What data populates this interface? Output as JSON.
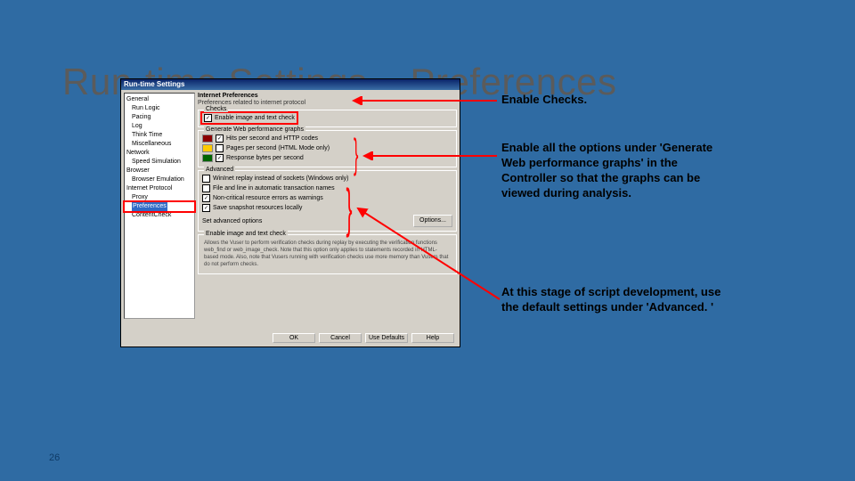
{
  "title": "Run-time Settings – Preferences",
  "pageNumber": "26",
  "annotations": {
    "a1": "Enable Checks.",
    "a2": "Enable all the options under 'Generate Web performance graphs' in the Controller so that the graphs can be viewed during analysis.",
    "a3": "At this stage of script development, use the default settings under 'Advanced. '"
  },
  "dialog": {
    "title": "Run-time Settings",
    "tree": {
      "cat1": "General",
      "i1": "Run Logic",
      "i2": "Pacing",
      "i3": "Log",
      "i4": "Think Time",
      "i5": "Miscellaneous",
      "cat2": "Network",
      "i6": "Speed Simulation",
      "cat3": "Browser",
      "i7": "Browser Emulation",
      "cat4": "Internet Protocol",
      "i8": "Proxy",
      "sel": "Preferences",
      "i9": "ContentCheck"
    },
    "pane": {
      "heading": "Internet Preferences",
      "sub": "Preferences related to internet protocol",
      "checksLabel": "Checks",
      "chk_img": "Enable image and text check",
      "graphsLabel": "Generate Web performance graphs",
      "g1": "Hits per second and HTTP codes",
      "g2": "Pages per second (HTML Mode only)",
      "g3": "Response bytes per second",
      "advLabel": "Advanced",
      "a1": "WinInet replay instead of sockets (Windows only)",
      "a2": "File and line in automatic transaction names",
      "a3": "Non-critical resource errors as warnings",
      "a4": "Save snapshot resources locally",
      "optLabel": "Set advanced options",
      "optBtn": "Options...",
      "hintTitle": "Enable image and text check",
      "hint": "Allows the Vuser to perform verification checks during replay by executing the verification functions web_find or web_image_check. Note that this option only applies to statements recorded in HTML-based mode. Also, note that Vusers running with verification checks use more memory than Vusers that do not perform checks."
    },
    "buttons": {
      "ok": "OK",
      "cancel": "Cancel",
      "def": "Use Defaults",
      "help": "Help"
    }
  }
}
